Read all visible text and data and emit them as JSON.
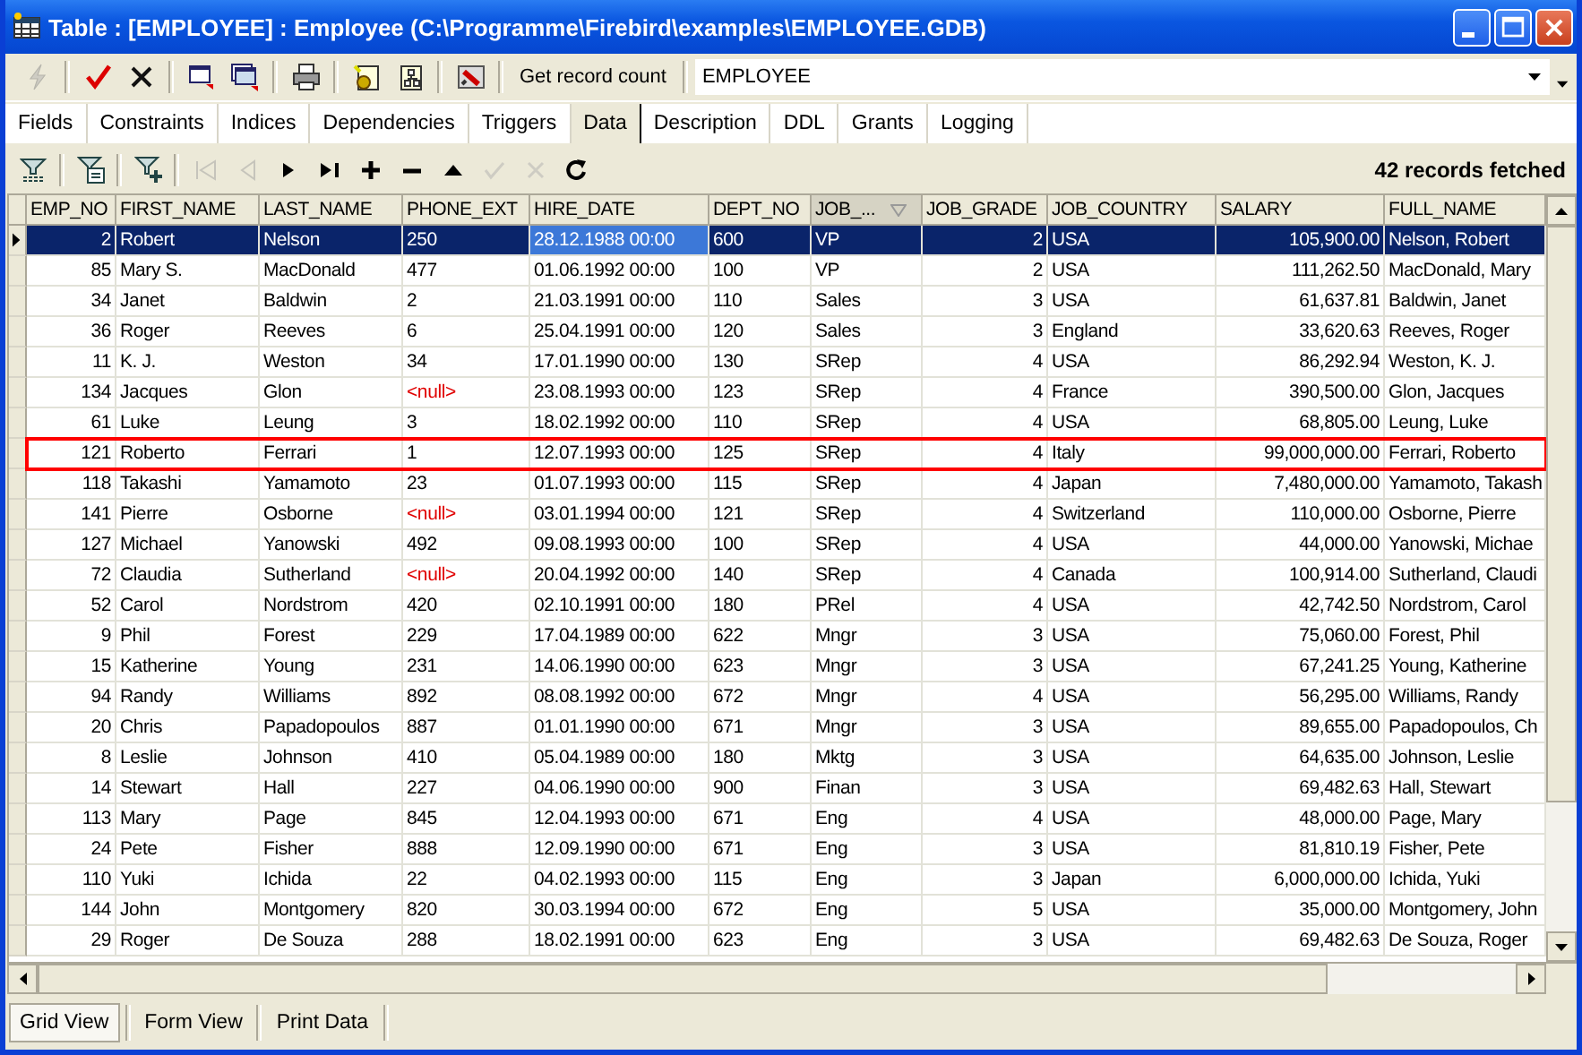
{
  "window": {
    "title": "Table : [EMPLOYEE] : Employee (C:\\Programme\\Firebird\\examples\\EMPLOYEE.GDB)"
  },
  "toolbar": {
    "buttons": [
      {
        "disabled": true
      },
      {
        "disabled": false
      },
      {
        "disabled": false
      },
      {
        "disabled": false
      },
      {
        "disabled": false
      },
      {
        "disabled": false
      },
      {
        "disabled": false
      },
      {
        "disabled": false
      },
      {
        "disabled": false
      }
    ],
    "record_count_button": "Get record count",
    "table_combo": "EMPLOYEE"
  },
  "tabs": [
    {
      "label": "Fields",
      "selected": false
    },
    {
      "label": "Constraints",
      "selected": false
    },
    {
      "label": "Indices",
      "selected": false
    },
    {
      "label": "Dependencies",
      "selected": false
    },
    {
      "label": "Triggers",
      "selected": false
    },
    {
      "label": "Data",
      "selected": true
    },
    {
      "label": "Description",
      "selected": false
    },
    {
      "label": "DDL",
      "selected": false
    },
    {
      "label": "Grants",
      "selected": false
    },
    {
      "label": "Logging",
      "selected": false
    }
  ],
  "navigator": {
    "buttons": [
      {
        "disabled": false
      },
      {
        "disabled": false
      },
      {
        "disabled": false
      },
      {
        "disabled": true
      },
      {
        "disabled": true
      },
      {
        "disabled": false
      },
      {
        "disabled": false
      },
      {
        "disabled": false
      },
      {
        "disabled": false
      },
      {
        "disabled": false
      },
      {
        "disabled": true
      },
      {
        "disabled": true
      },
      {
        "disabled": false
      }
    ],
    "status": "42 records fetched"
  },
  "table": {
    "columns": [
      {
        "label": "EMP_NO",
        "sorted": false
      },
      {
        "label": "FIRST_NAME",
        "sorted": false
      },
      {
        "label": "LAST_NAME",
        "sorted": false
      },
      {
        "label": "PHONE_EXT",
        "sorted": false
      },
      {
        "label": "HIRE_DATE",
        "sorted": false
      },
      {
        "label": "DEPT_NO",
        "sorted": false
      },
      {
        "label": "JOB_...",
        "sorted": true
      },
      {
        "label": "JOB_GRADE",
        "sorted": false
      },
      {
        "label": "JOB_COUNTRY",
        "sorted": false
      },
      {
        "label": "SALARY",
        "sorted": false
      },
      {
        "label": "FULL_NAME",
        "sorted": false
      }
    ],
    "rows": [
      {
        "cells": [
          "2",
          "Robert",
          "Nelson",
          "250",
          "28.12.1988 00:00",
          "600",
          "VP",
          "2",
          "USA",
          "105,900.00",
          "Nelson, Robert"
        ],
        "selected": true,
        "outlined": false,
        "phone_null": false
      },
      {
        "cells": [
          "85",
          "Mary S.",
          "MacDonald",
          "477",
          "01.06.1992 00:00",
          "100",
          "VP",
          "2",
          "USA",
          "111,262.50",
          "MacDonald, Mary"
        ],
        "selected": false,
        "outlined": false,
        "phone_null": false
      },
      {
        "cells": [
          "34",
          "Janet",
          "Baldwin",
          "2",
          "21.03.1991 00:00",
          "110",
          "Sales",
          "3",
          "USA",
          "61,637.81",
          "Baldwin, Janet"
        ],
        "selected": false,
        "outlined": false,
        "phone_null": false
      },
      {
        "cells": [
          "36",
          "Roger",
          "Reeves",
          "6",
          "25.04.1991 00:00",
          "120",
          "Sales",
          "3",
          "England",
          "33,620.63",
          "Reeves, Roger"
        ],
        "selected": false,
        "outlined": false,
        "phone_null": false
      },
      {
        "cells": [
          "11",
          "K. J.",
          "Weston",
          "34",
          "17.01.1990 00:00",
          "130",
          "SRep",
          "4",
          "USA",
          "86,292.94",
          "Weston, K. J."
        ],
        "selected": false,
        "outlined": false,
        "phone_null": false
      },
      {
        "cells": [
          "134",
          "Jacques",
          "Glon",
          "<null>",
          "23.08.1993 00:00",
          "123",
          "SRep",
          "4",
          "France",
          "390,500.00",
          "Glon, Jacques"
        ],
        "selected": false,
        "outlined": false,
        "phone_null": true
      },
      {
        "cells": [
          "61",
          "Luke",
          "Leung",
          "3",
          "18.02.1992 00:00",
          "110",
          "SRep",
          "4",
          "USA",
          "68,805.00",
          "Leung, Luke"
        ],
        "selected": false,
        "outlined": false,
        "phone_null": false
      },
      {
        "cells": [
          "121",
          "Roberto",
          "Ferrari",
          "1",
          "12.07.1993 00:00",
          "125",
          "SRep",
          "4",
          "Italy",
          "99,000,000.00",
          "Ferrari, Roberto"
        ],
        "selected": false,
        "outlined": true,
        "phone_null": false
      },
      {
        "cells": [
          "118",
          "Takashi",
          "Yamamoto",
          "23",
          "01.07.1993 00:00",
          "115",
          "SRep",
          "4",
          "Japan",
          "7,480,000.00",
          "Yamamoto, Takash"
        ],
        "selected": false,
        "outlined": false,
        "phone_null": false
      },
      {
        "cells": [
          "141",
          "Pierre",
          "Osborne",
          "<null>",
          "03.01.1994 00:00",
          "121",
          "SRep",
          "4",
          "Switzerland",
          "110,000.00",
          "Osborne, Pierre"
        ],
        "selected": false,
        "outlined": false,
        "phone_null": true
      },
      {
        "cells": [
          "127",
          "Michael",
          "Yanowski",
          "492",
          "09.08.1993 00:00",
          "100",
          "SRep",
          "4",
          "USA",
          "44,000.00",
          "Yanowski, Michae"
        ],
        "selected": false,
        "outlined": false,
        "phone_null": false
      },
      {
        "cells": [
          "72",
          "Claudia",
          "Sutherland",
          "<null>",
          "20.04.1992 00:00",
          "140",
          "SRep",
          "4",
          "Canada",
          "100,914.00",
          "Sutherland, Claudi"
        ],
        "selected": false,
        "outlined": false,
        "phone_null": true
      },
      {
        "cells": [
          "52",
          "Carol",
          "Nordstrom",
          "420",
          "02.10.1991 00:00",
          "180",
          "PRel",
          "4",
          "USA",
          "42,742.50",
          "Nordstrom, Carol"
        ],
        "selected": false,
        "outlined": false,
        "phone_null": false
      },
      {
        "cells": [
          "9",
          "Phil",
          "Forest",
          "229",
          "17.04.1989 00:00",
          "622",
          "Mngr",
          "3",
          "USA",
          "75,060.00",
          "Forest, Phil"
        ],
        "selected": false,
        "outlined": false,
        "phone_null": false
      },
      {
        "cells": [
          "15",
          "Katherine",
          "Young",
          "231",
          "14.06.1990 00:00",
          "623",
          "Mngr",
          "3",
          "USA",
          "67,241.25",
          "Young, Katherine"
        ],
        "selected": false,
        "outlined": false,
        "phone_null": false
      },
      {
        "cells": [
          "94",
          "Randy",
          "Williams",
          "892",
          "08.08.1992 00:00",
          "672",
          "Mngr",
          "4",
          "USA",
          "56,295.00",
          "Williams, Randy"
        ],
        "selected": false,
        "outlined": false,
        "phone_null": false
      },
      {
        "cells": [
          "20",
          "Chris",
          "Papadopoulos",
          "887",
          "01.01.1990 00:00",
          "671",
          "Mngr",
          "3",
          "USA",
          "89,655.00",
          "Papadopoulos, Ch"
        ],
        "selected": false,
        "outlined": false,
        "phone_null": false
      },
      {
        "cells": [
          "8",
          "Leslie",
          "Johnson",
          "410",
          "05.04.1989 00:00",
          "180",
          "Mktg",
          "3",
          "USA",
          "64,635.00",
          "Johnson, Leslie"
        ],
        "selected": false,
        "outlined": false,
        "phone_null": false
      },
      {
        "cells": [
          "14",
          "Stewart",
          "Hall",
          "227",
          "04.06.1990 00:00",
          "900",
          "Finan",
          "3",
          "USA",
          "69,482.63",
          "Hall, Stewart"
        ],
        "selected": false,
        "outlined": false,
        "phone_null": false
      },
      {
        "cells": [
          "113",
          "Mary",
          "Page",
          "845",
          "12.04.1993 00:00",
          "671",
          "Eng",
          "4",
          "USA",
          "48,000.00",
          "Page, Mary"
        ],
        "selected": false,
        "outlined": false,
        "phone_null": false
      },
      {
        "cells": [
          "24",
          "Pete",
          "Fisher",
          "888",
          "12.09.1990 00:00",
          "671",
          "Eng",
          "3",
          "USA",
          "81,810.19",
          "Fisher, Pete"
        ],
        "selected": false,
        "outlined": false,
        "phone_null": false
      },
      {
        "cells": [
          "110",
          "Yuki",
          "Ichida",
          "22",
          "04.02.1993 00:00",
          "115",
          "Eng",
          "3",
          "Japan",
          "6,000,000.00",
          "Ichida, Yuki"
        ],
        "selected": false,
        "outlined": false,
        "phone_null": false
      },
      {
        "cells": [
          "144",
          "John",
          "Montgomery",
          "820",
          "30.03.1994 00:00",
          "672",
          "Eng",
          "5",
          "USA",
          "35,000.00",
          "Montgomery, John"
        ],
        "selected": false,
        "outlined": false,
        "phone_null": false
      },
      {
        "cells": [
          "29",
          "Roger",
          "De Souza",
          "288",
          "18.02.1991 00:00",
          "623",
          "Eng",
          "3",
          "USA",
          "69,482.63",
          "De Souza, Roger"
        ],
        "selected": false,
        "outlined": false,
        "phone_null": false
      }
    ]
  },
  "view_tabs": [
    {
      "label": "Grid View",
      "selected": true
    },
    {
      "label": "Form View",
      "selected": false
    },
    {
      "label": "Print Data",
      "selected": false
    }
  ]
}
